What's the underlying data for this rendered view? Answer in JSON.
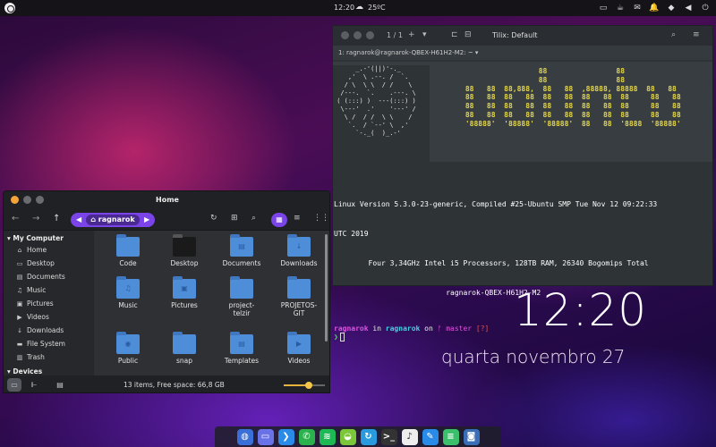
{
  "topbar": {
    "time": "12:20",
    "weather_icon": "cloud-sun-icon",
    "temperature": "25ºC"
  },
  "terminal": {
    "tab_count": "1 / 1",
    "title": "Tilix: Default",
    "session": "1: ragnarok@ragnarok-QBEX-H61H2-M2: ~",
    "ascii_logo": "      _.-'(||)'-._\n    ,'  \\ .--. /  `.\n   / \\  \\ \\  / /    \\\n  /---.  `.    .---. \\\n ( (:::) )  ---(:::) )\n  \\---'  .'    '---' /\n   \\ /  / /  \\ \\    /\n    `.  / `--' \\  ,'\n      `-._(  )_.-'",
    "ascii_banner": "                  88                88\n                  88                88\n 88   88  88,888,  88   88  ,88888, 88888  88   88\n 88   88  88   88  88   88  88   88  88     88   88\n 88   88  88   88  88   88  88   88  88     88   88\n 88   88  88   88  88   88  88   88  88     88   88\n '88888'  '88888'  '88888'  88   88  '8888  '88888'",
    "sysinfo_lines": [
      "Linux Version 5.3.0-23-generic, Compiled #25-Ubuntu SMP Tue Nov 12 09:22:33",
      "UTC 2019",
      "        Four 3,34GHz Intel i5 Processors, 128TB RAM, 26340 Bogomips Total",
      "                          ragnarok-QBEX-H61H2-M2"
    ],
    "prompt": {
      "user": "ragnarok",
      "in": " in ",
      "host": "ragnarok",
      "on": " on ",
      "branch": "ᚠ master",
      "status": " [?]"
    },
    "cursor_prompt": "❯"
  },
  "clock_widget": {
    "time": "12:20",
    "date": "quarta novembro 27"
  },
  "file_manager": {
    "title": "Home",
    "path_crumb": "ragnarok",
    "sidebar_heading": "My Computer",
    "sidebar_items": [
      {
        "label": "Home",
        "icon": "home-icon"
      },
      {
        "label": "Desktop",
        "icon": "desktop-icon"
      },
      {
        "label": "Documents",
        "icon": "document-icon"
      },
      {
        "label": "Music",
        "icon": "music-icon"
      },
      {
        "label": "Pictures",
        "icon": "picture-icon"
      },
      {
        "label": "Videos",
        "icon": "video-icon"
      },
      {
        "label": "Downloads",
        "icon": "download-icon"
      },
      {
        "label": "File System",
        "icon": "drive-icon"
      },
      {
        "label": "Trash",
        "icon": "trash-icon"
      }
    ],
    "sidebar_heading2": "Devices",
    "files": [
      {
        "name": "Code",
        "glyph": ""
      },
      {
        "name": "Desktop",
        "glyph": ""
      },
      {
        "name": "Documents",
        "glyph": "▤"
      },
      {
        "name": "Downloads",
        "glyph": "↓"
      },
      {
        "name": "Music",
        "glyph": "♫"
      },
      {
        "name": "Pictures",
        "glyph": "▣"
      },
      {
        "name": "project-\ntelzir",
        "glyph": ""
      },
      {
        "name": "PROJETOS-\nGIT",
        "glyph": ""
      },
      {
        "name": "Public",
        "glyph": "◉"
      },
      {
        "name": "snap",
        "glyph": ""
      },
      {
        "name": "Templates",
        "glyph": "▤"
      },
      {
        "name": "Videos",
        "glyph": "▶"
      }
    ],
    "status": "13 items, Free space: 66,8 GB",
    "zoom_level": 0.6
  },
  "dock": {
    "apps": [
      {
        "name": "browser-icon",
        "color": "#3a6fd8",
        "glyph": "◍"
      },
      {
        "name": "files-icon",
        "color": "#6a72e8",
        "glyph": "▭"
      },
      {
        "name": "vscode-icon",
        "color": "#2a8ae8",
        "glyph": "❯"
      },
      {
        "name": "whatsapp-icon",
        "color": "#2bb24c",
        "glyph": "✆"
      },
      {
        "name": "spotify-icon",
        "color": "#1db954",
        "glyph": "≋"
      },
      {
        "name": "android-icon",
        "color": "#7cc63a",
        "glyph": "◒"
      },
      {
        "name": "refresh-icon",
        "color": "#2a9adf",
        "glyph": "↻"
      },
      {
        "name": "terminal-icon",
        "color": "#333333",
        "glyph": ">_"
      },
      {
        "name": "music-player-icon",
        "color": "#eeeeee",
        "glyph": "♪"
      },
      {
        "name": "editor-icon",
        "color": "#2a8ae8",
        "glyph": "✎"
      },
      {
        "name": "notes-icon",
        "color": "#3ac06a",
        "glyph": "≡"
      },
      {
        "name": "camera-icon",
        "color": "#3a6fb8",
        "glyph": "◙"
      }
    ]
  }
}
